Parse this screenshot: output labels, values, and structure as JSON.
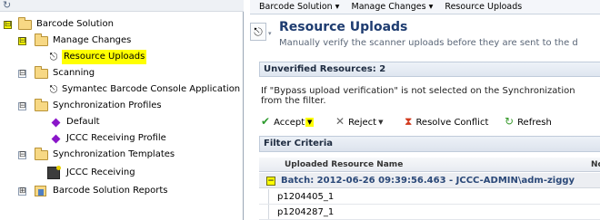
{
  "tree": {
    "items": [
      {
        "label": "Barcode Solution",
        "expander": "⊟"
      },
      {
        "label": "Manage Changes",
        "expander": "⊟"
      },
      {
        "label": "Resource Uploads"
      },
      {
        "label": "Scanning",
        "expander": "⊟"
      },
      {
        "label": "Symantec Barcode Console Application"
      },
      {
        "label": "Synchronization Profiles",
        "expander": "⊟"
      },
      {
        "label": "Default"
      },
      {
        "label": "JCCC Receiving Profile"
      },
      {
        "label": "Synchronization Templates",
        "expander": "⊟"
      },
      {
        "label": "JCCC Receiving"
      },
      {
        "label": "Barcode Solution Reports",
        "expander": "⊞"
      }
    ]
  },
  "breadcrumb": [
    "Barcode Solution ▾",
    "Manage Changes ▾",
    "Resource Uploads"
  ],
  "header": {
    "title": "Resource Uploads",
    "subtitle": "Manually verify the scanner uploads before they are sent to the d"
  },
  "unverified": {
    "label": "Unverified Resources: 2"
  },
  "info": {
    "line1": "If \"Bypass upload verification\" is not selected on the Synchronization",
    "line2": "from the filter."
  },
  "toolbar": {
    "accept": "Accept",
    "reject": "Reject",
    "resolve": "Resolve Conflict",
    "refresh": "Refresh"
  },
  "filter": {
    "label": "Filter Criteria"
  },
  "columns": {
    "name": "Uploaded Resource Name",
    "next": "Nc"
  },
  "batch": {
    "label": "Batch: 2012-06-26 09:39:56.463 - JCCC-ADMIN\\adm-ziggy"
  },
  "rows": [
    "p1204405_1",
    "p1204287_1"
  ],
  "colors": {
    "highlight": "#ffff00",
    "title": "#1e3c70",
    "diamond": "#8a16c9"
  }
}
